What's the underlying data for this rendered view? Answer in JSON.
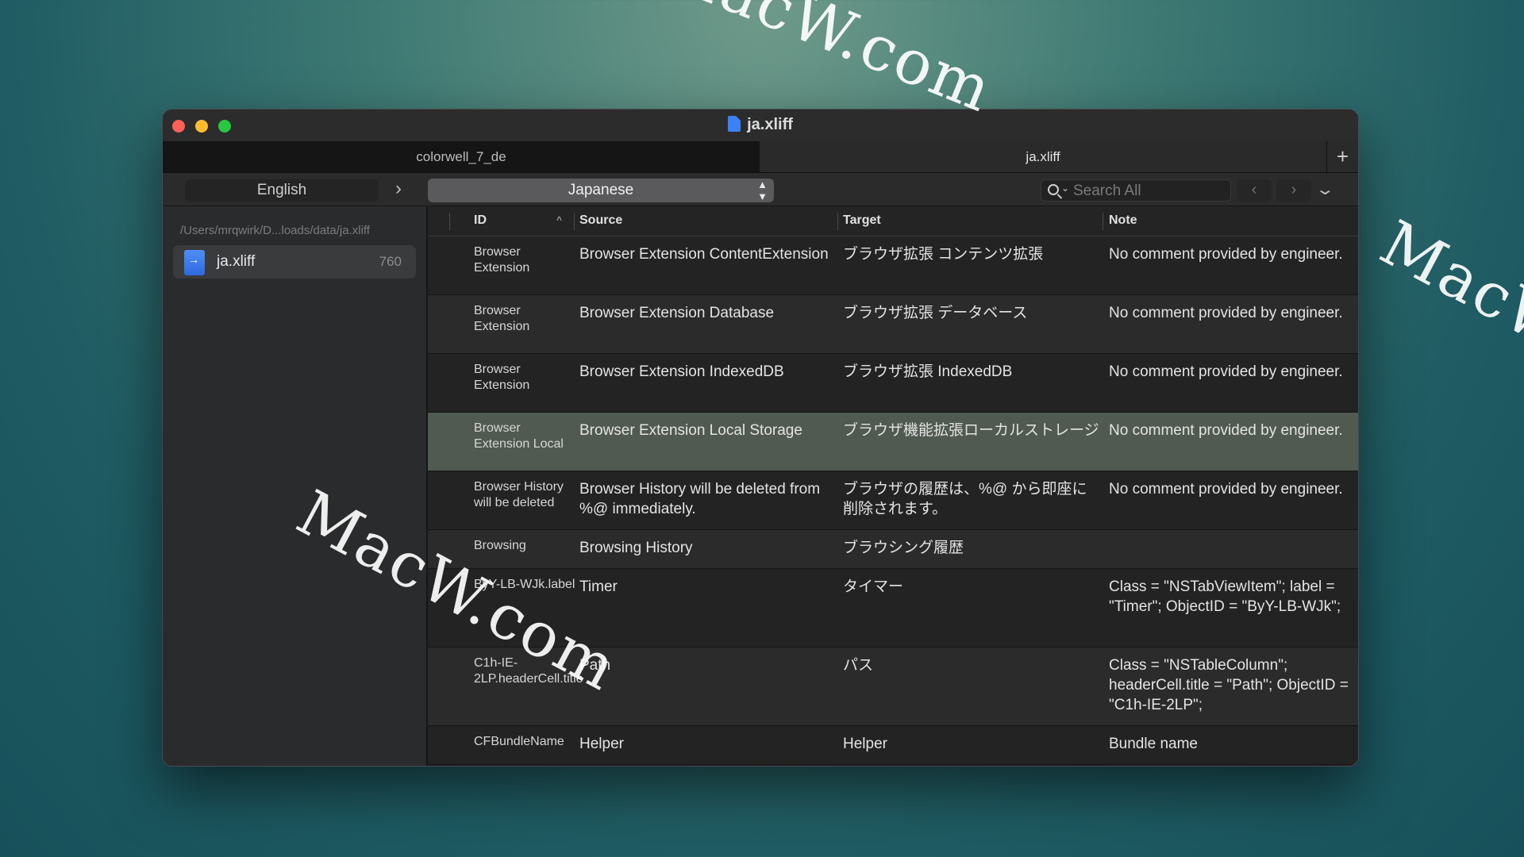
{
  "window": {
    "title": "ja.xliff",
    "tabs": [
      {
        "label": "colorwell_7_de",
        "active": false
      },
      {
        "label": "ja.xliff",
        "active": true
      }
    ],
    "add_tab_label": "+"
  },
  "toolbar": {
    "source_language": "English",
    "target_language": "Japanese",
    "search_placeholder": "Search All"
  },
  "sidebar": {
    "path": "/Users/mrqwirk/D...loads/data/ja.xliff",
    "files": [
      {
        "name": "ja.xliff",
        "count": "760"
      }
    ]
  },
  "table": {
    "columns": {
      "id": "ID",
      "source": "Source",
      "target": "Target",
      "note": "Note"
    },
    "rows": [
      {
        "id": "Browser Extension",
        "source": "Browser Extension ContentExtension",
        "target": "ブラウザ拡張 コンテンツ拡張",
        "note": "No comment provided by engineer."
      },
      {
        "id": "Browser Extension",
        "source": "Browser Extension Database",
        "target": "ブラウザ拡張 データベース",
        "note": "No comment provided by engineer."
      },
      {
        "id": "Browser Extension",
        "source": "Browser Extension IndexedDB",
        "target": "ブラウザ拡張 IndexedDB",
        "note": "No comment provided by engineer."
      },
      {
        "id": "Browser Extension Local",
        "source": "Browser Extension Local Storage",
        "target": "ブラウザ機能拡張ローカルストレージ",
        "note": "No comment provided by engineer.",
        "selected": true
      },
      {
        "id": "Browser History will be deleted",
        "source": "Browser History will be deleted from %@ immediately.",
        "target": "ブラウザの履歴は、%@ から即座に削除されます。",
        "note": "No comment provided by engineer."
      },
      {
        "id": "Browsing",
        "source": "Browsing History",
        "target": "ブラウシング履歴",
        "note": ""
      },
      {
        "id": "ByY-LB-WJk.label",
        "source": "Timer",
        "target": "タイマー",
        "note": "Class = \"NSTabViewItem\"; label = \"Timer\"; ObjectID = \"ByY-LB-WJk\";"
      },
      {
        "id": "C1h-IE-2LP.headerCell.title",
        "source": "Path",
        "target": "パス",
        "note": "Class = \"NSTableColumn\"; headerCell.title = \"Path\"; ObjectID = \"C1h-IE-2LP\";"
      },
      {
        "id": "CFBundleName",
        "source": "Helper",
        "target": "Helper",
        "note": "Bundle name"
      }
    ]
  },
  "watermark": "MacW.com",
  "colors": {
    "close": "#fe5f57",
    "minimize": "#febc2e",
    "maximize": "#28c840",
    "selected_row": "#505a50"
  }
}
